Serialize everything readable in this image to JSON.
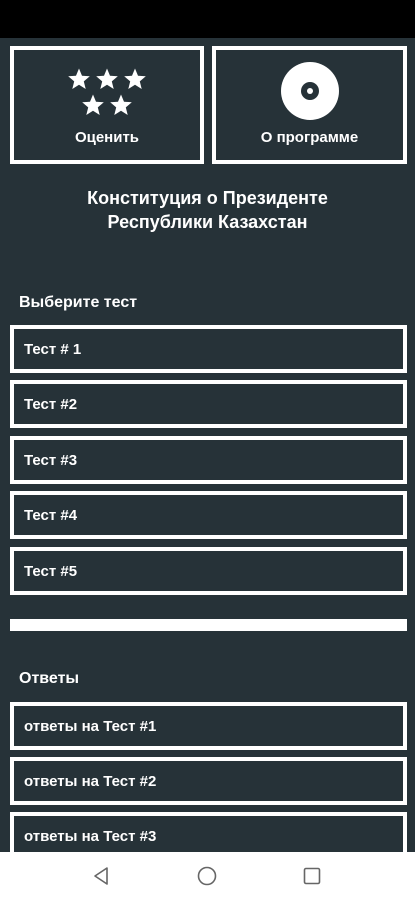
{
  "top_buttons": {
    "rate_label": "Оценить",
    "about_label": "О программе"
  },
  "title_line1": "Конституция о Президенте",
  "title_line2": "Республики Казахстан",
  "tests_section": {
    "label": "Выберите тест",
    "items": [
      {
        "label": "Тест # 1"
      },
      {
        "label": "Тест #2"
      },
      {
        "label": "Тест #3"
      },
      {
        "label": "Тест #4"
      },
      {
        "label": "Тест #5"
      }
    ]
  },
  "answers_section": {
    "label": "Ответы",
    "items": [
      {
        "label": "ответы на Тест #1"
      },
      {
        "label": "ответы на Тест #2"
      },
      {
        "label": "ответы на Тест #3"
      }
    ]
  },
  "icons": {
    "rate": "star-icon",
    "about": "disc-icon",
    "nav_back": "back-triangle-icon",
    "nav_home": "home-circle-icon",
    "nav_recents": "recents-square-icon"
  },
  "colors": {
    "background": "#263238",
    "border": "#ffffff",
    "text": "#ffffff"
  }
}
